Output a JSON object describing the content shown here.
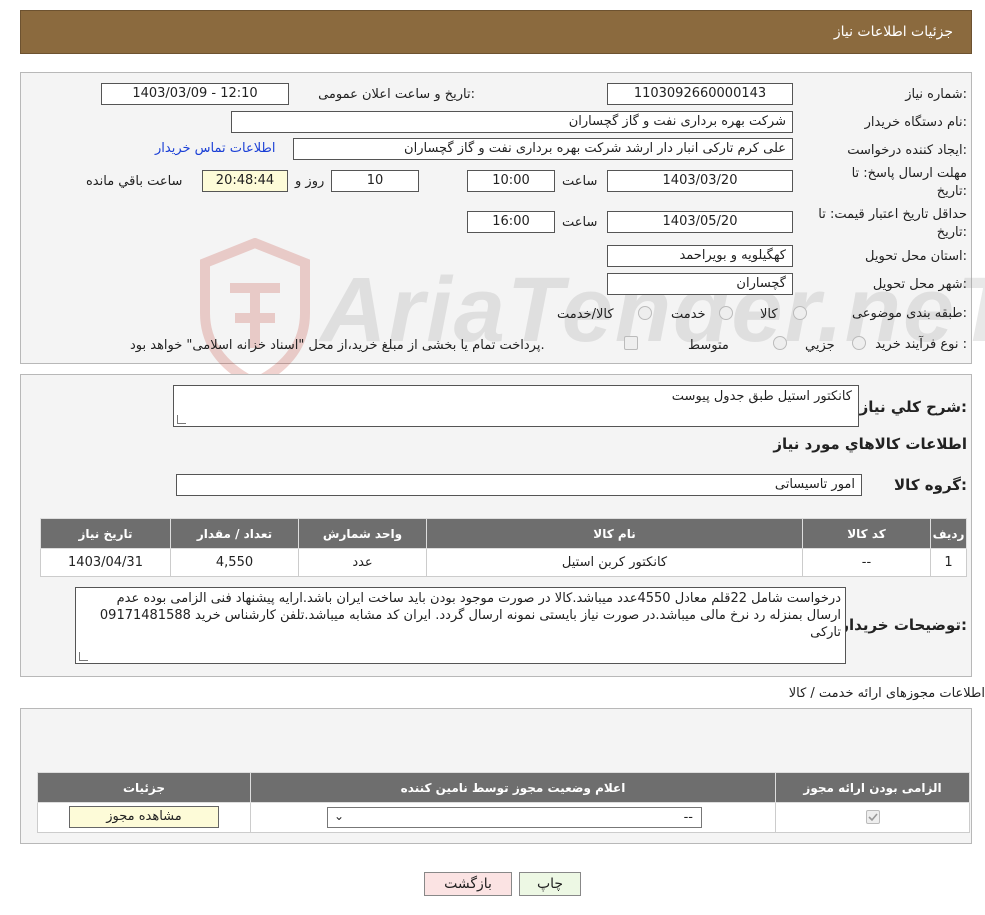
{
  "header": {
    "title": "جزئیات اطلاعات نیاز"
  },
  "watermark": {
    "text": "AriaTender.neT"
  },
  "form": {
    "need_number_label": "شماره نیاز:",
    "need_number": "1103092660000143",
    "announce_label": "تاریخ و ساعت اعلان عمومی:",
    "announce_value": "1403/03/09 - 12:10",
    "buyer_org_label": "نام دستگاه خریدار:",
    "buyer_org": "شرکت بهره برداری نفت و گاز گچساران",
    "creator_label": "ایجاد کننده درخواست:",
    "creator": "علی کرم تارکی انبار دار ارشد شرکت بهره برداری نفت و گاز گچساران",
    "contact_link": "اطلاعات تماس خریدار",
    "deadline_label_1": "مهلت ارسال پاسخ: تا",
    "deadline_label_2": "تاریخ:",
    "deadline_date": "1403/03/20",
    "time_label": "ساعت",
    "deadline_time": "10:00",
    "days_value": "10",
    "days_label": "روز و",
    "remaining_time": "20:48:44",
    "remaining_label": "ساعت باقي مانده",
    "validity_label_1": "حداقل تاریخ اعتبار قیمت: تا",
    "validity_label_2": "تاریخ:",
    "validity_date": "1403/05/20",
    "validity_time": "16:00",
    "province_label": "استان محل تحویل:",
    "province": "کهگیلویه و بویراحمد",
    "city_label": "شهر محل تحویل:",
    "city": "گچساران",
    "category_label": "طبقه بندی موضوعی:",
    "category_options": [
      "کالا",
      "خدمت",
      "کالا/خدمت"
    ],
    "process_label": "نوع فرآیند خرید :",
    "process_options": [
      "جزیي",
      "متوسط"
    ],
    "payment_note": "پرداخت تمام یا بخشی از مبلغ خرید،از محل \"اسناد خزانه اسلامی\" خواهد بود."
  },
  "details": {
    "summary_label": "شرح کلي نياز:",
    "summary": "کانکتور استیل طبق جدول پیوست",
    "goods_title": "اطلاعات کالاهاي مورد نياز",
    "group_label": "گروه کالا:",
    "group": "امور تاسیساتی",
    "table": {
      "headers": [
        "رديف",
        "کد کالا",
        "نام کالا",
        "واحد شمارش",
        "تعداد / مقدار",
        "تاریخ نیاز"
      ],
      "rows": [
        [
          "1",
          "--",
          "کانکتور کربن استیل",
          "عدد",
          "4,550",
          "1403/04/31"
        ]
      ]
    },
    "buyer_notes_label": "توضیحات خریدار:",
    "buyer_notes": "درخواست شامل 22قلم معادل 4550عدد میباشد.کالا در صورت موجود بودن باید ساخت ایران باشد.ارایه پیشنهاد فنی الزامی بوده عدم ارسال بمنزله رد نرخ مالی میباشد.در صورت نیاز بایستی نمونه ارسال گردد. ایران کد مشابه میباشد.تلفن کارشناس خرید 09171481588 تارکی"
  },
  "licenses": {
    "title": "اطلاعات مجوزهای ارائه خدمت / کالا",
    "headers": [
      "الزامی بودن ارائه مجوز",
      "اعلام وضعیت مجوز توسط نامین کننده",
      "جزئیات"
    ],
    "select_value": "--",
    "view_button": "مشاهده مجوز"
  },
  "actions": {
    "print": "چاپ",
    "back": "بازگشت"
  }
}
